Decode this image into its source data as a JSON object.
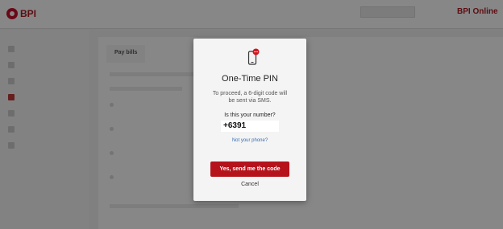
{
  "header": {
    "brand_logo": "BPI",
    "product": "BPI Online"
  },
  "sidebar": {
    "items": [
      {
        "icon": "home-icon",
        "active": false
      },
      {
        "icon": "accounts-icon",
        "active": false
      },
      {
        "icon": "list-icon",
        "active": false
      },
      {
        "icon": "payments-icon",
        "active": true
      },
      {
        "icon": "transfer-icon",
        "active": false
      },
      {
        "icon": "settings-icon",
        "active": false
      },
      {
        "icon": "info-icon",
        "active": false
      }
    ]
  },
  "tabs": [
    {
      "label": "Pay bills"
    }
  ],
  "modal": {
    "icon": "phone-sms-icon",
    "title": "One-Time PIN",
    "description": "To proceed, a 6-digit code will be sent via SMS.",
    "question": "Is this your number?",
    "phone_value": "+6391",
    "not_your_phone": "Not your phone?",
    "send_button": "Yes, send me the code",
    "cancel_button": "Cancel"
  },
  "colors": {
    "accent": "#b5121b",
    "link": "#3a6fb0"
  }
}
